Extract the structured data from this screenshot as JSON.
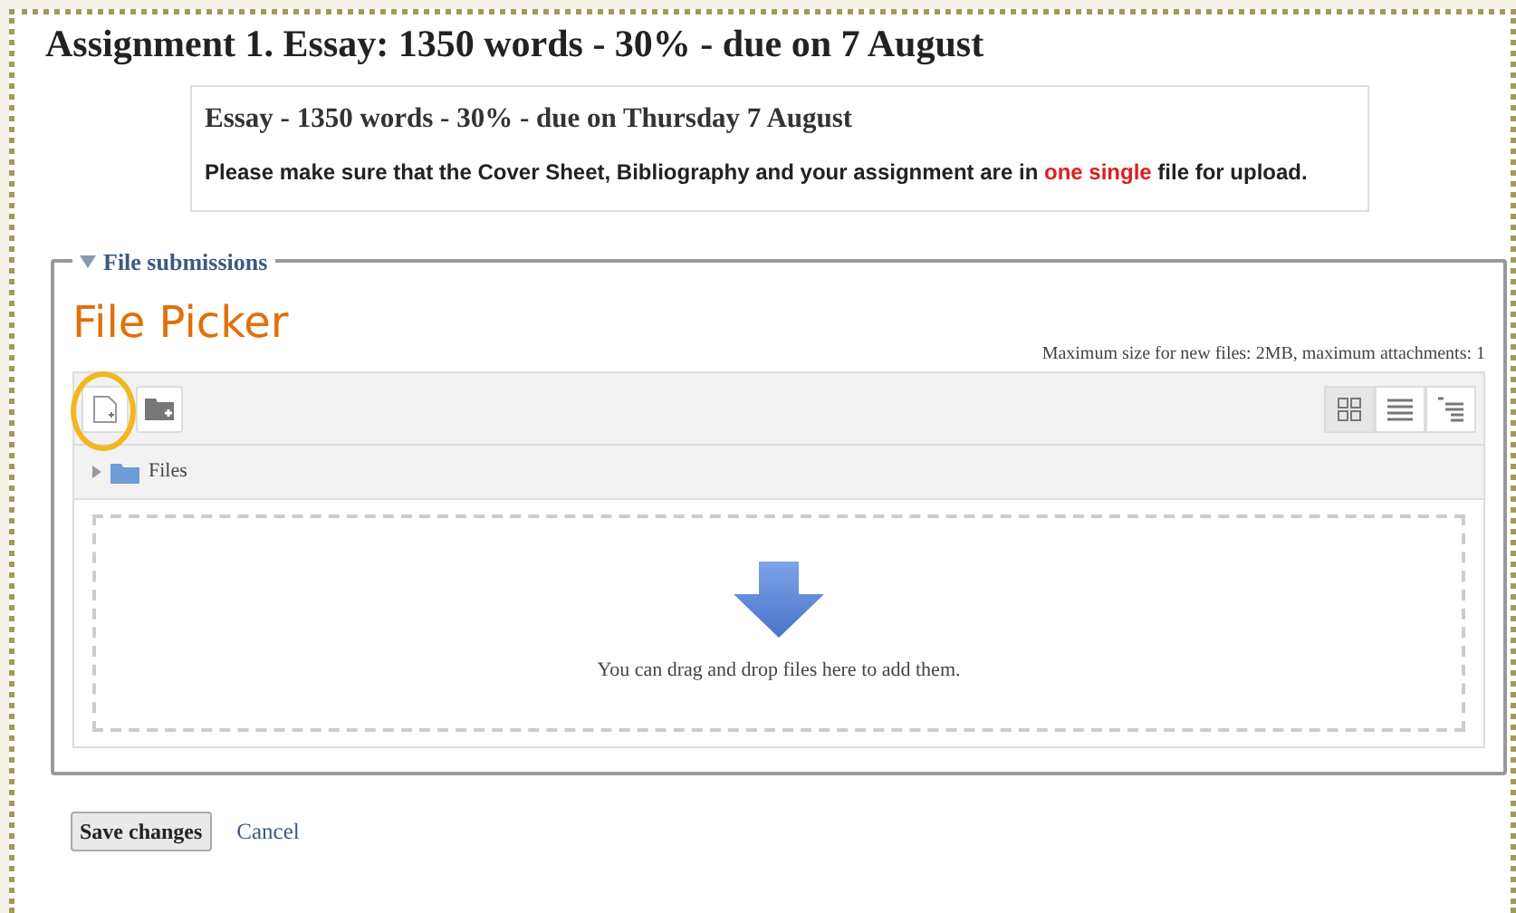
{
  "title": "Assignment 1. Essay: 1350 words - 30% - due on 7 August",
  "intro": {
    "heading": "Essay - 1350 words - 30% - due on Thursday 7 August",
    "text_parts": [
      {
        "text": "Please make sure that the Cover Sheet, Bibliography and your assignment are in ",
        "highlight": false
      },
      {
        "text": "one single",
        "highlight": true
      },
      {
        "text": " file for upload.",
        "highlight": false
      }
    ]
  },
  "fieldset": {
    "legend": "File submissions",
    "expanded": true,
    "annotation": {
      "label": "File Picker"
    },
    "limits": "Maximum size for new files: 2MB, maximum attachments: 1",
    "toolbar": [
      {
        "kind": "add-file",
        "circled": true
      },
      {
        "kind": "add-folder",
        "circled": false
      }
    ],
    "views": [
      {
        "kind": "icons",
        "selected": true
      },
      {
        "kind": "list",
        "selected": false
      },
      {
        "kind": "tree",
        "selected": false
      }
    ],
    "path": "Files",
    "drop_hint": "You can drag and drop files here to add them."
  },
  "buttons": [
    {
      "kind": "submit",
      "label": "Save changes"
    },
    {
      "kind": "link",
      "label": "Cancel"
    }
  ]
}
